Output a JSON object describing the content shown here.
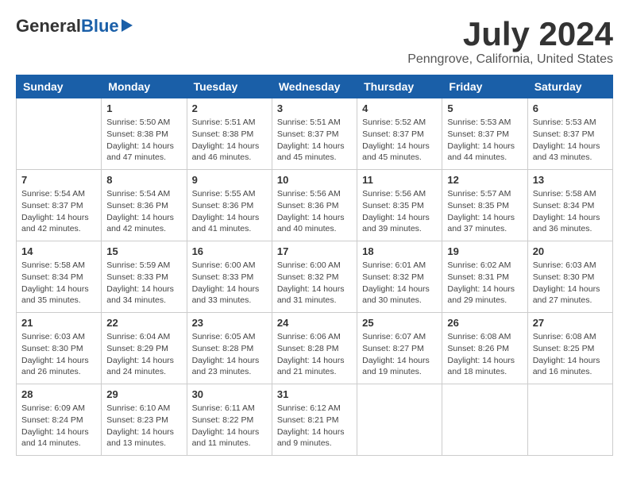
{
  "header": {
    "logo_general": "General",
    "logo_blue": "Blue",
    "month_title": "July 2024",
    "location": "Penngrove, California, United States"
  },
  "days_of_week": [
    "Sunday",
    "Monday",
    "Tuesday",
    "Wednesday",
    "Thursday",
    "Friday",
    "Saturday"
  ],
  "weeks": [
    [
      {
        "day": "",
        "info": ""
      },
      {
        "day": "1",
        "info": "Sunrise: 5:50 AM\nSunset: 8:38 PM\nDaylight: 14 hours\nand 47 minutes."
      },
      {
        "day": "2",
        "info": "Sunrise: 5:51 AM\nSunset: 8:38 PM\nDaylight: 14 hours\nand 46 minutes."
      },
      {
        "day": "3",
        "info": "Sunrise: 5:51 AM\nSunset: 8:37 PM\nDaylight: 14 hours\nand 45 minutes."
      },
      {
        "day": "4",
        "info": "Sunrise: 5:52 AM\nSunset: 8:37 PM\nDaylight: 14 hours\nand 45 minutes."
      },
      {
        "day": "5",
        "info": "Sunrise: 5:53 AM\nSunset: 8:37 PM\nDaylight: 14 hours\nand 44 minutes."
      },
      {
        "day": "6",
        "info": "Sunrise: 5:53 AM\nSunset: 8:37 PM\nDaylight: 14 hours\nand 43 minutes."
      }
    ],
    [
      {
        "day": "7",
        "info": "Sunrise: 5:54 AM\nSunset: 8:37 PM\nDaylight: 14 hours\nand 42 minutes."
      },
      {
        "day": "8",
        "info": "Sunrise: 5:54 AM\nSunset: 8:36 PM\nDaylight: 14 hours\nand 42 minutes."
      },
      {
        "day": "9",
        "info": "Sunrise: 5:55 AM\nSunset: 8:36 PM\nDaylight: 14 hours\nand 41 minutes."
      },
      {
        "day": "10",
        "info": "Sunrise: 5:56 AM\nSunset: 8:36 PM\nDaylight: 14 hours\nand 40 minutes."
      },
      {
        "day": "11",
        "info": "Sunrise: 5:56 AM\nSunset: 8:35 PM\nDaylight: 14 hours\nand 39 minutes."
      },
      {
        "day": "12",
        "info": "Sunrise: 5:57 AM\nSunset: 8:35 PM\nDaylight: 14 hours\nand 37 minutes."
      },
      {
        "day": "13",
        "info": "Sunrise: 5:58 AM\nSunset: 8:34 PM\nDaylight: 14 hours\nand 36 minutes."
      }
    ],
    [
      {
        "day": "14",
        "info": "Sunrise: 5:58 AM\nSunset: 8:34 PM\nDaylight: 14 hours\nand 35 minutes."
      },
      {
        "day": "15",
        "info": "Sunrise: 5:59 AM\nSunset: 8:33 PM\nDaylight: 14 hours\nand 34 minutes."
      },
      {
        "day": "16",
        "info": "Sunrise: 6:00 AM\nSunset: 8:33 PM\nDaylight: 14 hours\nand 33 minutes."
      },
      {
        "day": "17",
        "info": "Sunrise: 6:00 AM\nSunset: 8:32 PM\nDaylight: 14 hours\nand 31 minutes."
      },
      {
        "day": "18",
        "info": "Sunrise: 6:01 AM\nSunset: 8:32 PM\nDaylight: 14 hours\nand 30 minutes."
      },
      {
        "day": "19",
        "info": "Sunrise: 6:02 AM\nSunset: 8:31 PM\nDaylight: 14 hours\nand 29 minutes."
      },
      {
        "day": "20",
        "info": "Sunrise: 6:03 AM\nSunset: 8:30 PM\nDaylight: 14 hours\nand 27 minutes."
      }
    ],
    [
      {
        "day": "21",
        "info": "Sunrise: 6:03 AM\nSunset: 8:30 PM\nDaylight: 14 hours\nand 26 minutes."
      },
      {
        "day": "22",
        "info": "Sunrise: 6:04 AM\nSunset: 8:29 PM\nDaylight: 14 hours\nand 24 minutes."
      },
      {
        "day": "23",
        "info": "Sunrise: 6:05 AM\nSunset: 8:28 PM\nDaylight: 14 hours\nand 23 minutes."
      },
      {
        "day": "24",
        "info": "Sunrise: 6:06 AM\nSunset: 8:28 PM\nDaylight: 14 hours\nand 21 minutes."
      },
      {
        "day": "25",
        "info": "Sunrise: 6:07 AM\nSunset: 8:27 PM\nDaylight: 14 hours\nand 19 minutes."
      },
      {
        "day": "26",
        "info": "Sunrise: 6:08 AM\nSunset: 8:26 PM\nDaylight: 14 hours\nand 18 minutes."
      },
      {
        "day": "27",
        "info": "Sunrise: 6:08 AM\nSunset: 8:25 PM\nDaylight: 14 hours\nand 16 minutes."
      }
    ],
    [
      {
        "day": "28",
        "info": "Sunrise: 6:09 AM\nSunset: 8:24 PM\nDaylight: 14 hours\nand 14 minutes."
      },
      {
        "day": "29",
        "info": "Sunrise: 6:10 AM\nSunset: 8:23 PM\nDaylight: 14 hours\nand 13 minutes."
      },
      {
        "day": "30",
        "info": "Sunrise: 6:11 AM\nSunset: 8:22 PM\nDaylight: 14 hours\nand 11 minutes."
      },
      {
        "day": "31",
        "info": "Sunrise: 6:12 AM\nSunset: 8:21 PM\nDaylight: 14 hours\nand 9 minutes."
      },
      {
        "day": "",
        "info": ""
      },
      {
        "day": "",
        "info": ""
      },
      {
        "day": "",
        "info": ""
      }
    ]
  ]
}
